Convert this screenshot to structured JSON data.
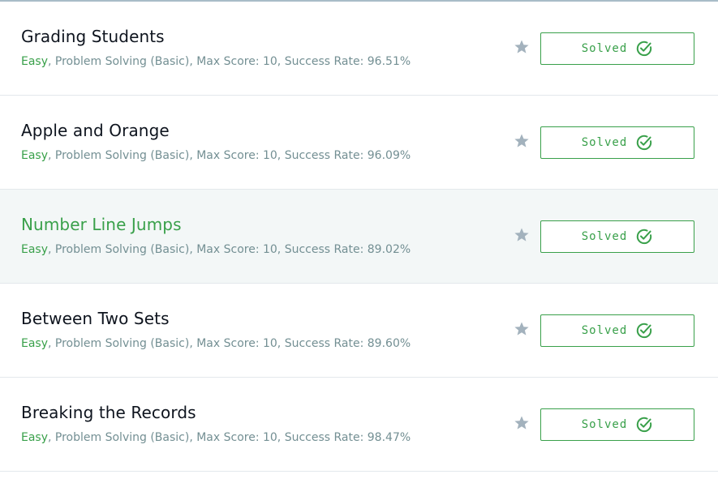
{
  "colors": {
    "accent_green": "#39a04a",
    "title_text": "#0e141e",
    "meta_text": "#738f93",
    "star_gray": "#a3b2bd",
    "hover_row_bg": "#f3f7f7"
  },
  "icons": {
    "star": "star-icon",
    "check": "check-circle-icon"
  },
  "challenges": [
    {
      "title": "Grading Students",
      "difficulty": "Easy",
      "details": ", Problem Solving (Basic), Max Score: 10, Success Rate: 96.51%",
      "status_label": "Solved",
      "hovered": false
    },
    {
      "title": "Apple and Orange",
      "difficulty": "Easy",
      "details": ", Problem Solving (Basic), Max Score: 10, Success Rate: 96.09%",
      "status_label": "Solved",
      "hovered": false
    },
    {
      "title": "Number Line Jumps",
      "difficulty": "Easy",
      "details": ", Problem Solving (Basic), Max Score: 10, Success Rate: 89.02%",
      "status_label": "Solved",
      "hovered": true
    },
    {
      "title": "Between Two Sets",
      "difficulty": "Easy",
      "details": ", Problem Solving (Basic), Max Score: 10, Success Rate: 89.60%",
      "status_label": "Solved",
      "hovered": false
    },
    {
      "title": "Breaking the Records",
      "difficulty": "Easy",
      "details": ", Problem Solving (Basic), Max Score: 10, Success Rate: 98.47%",
      "status_label": "Solved",
      "hovered": false
    }
  ]
}
